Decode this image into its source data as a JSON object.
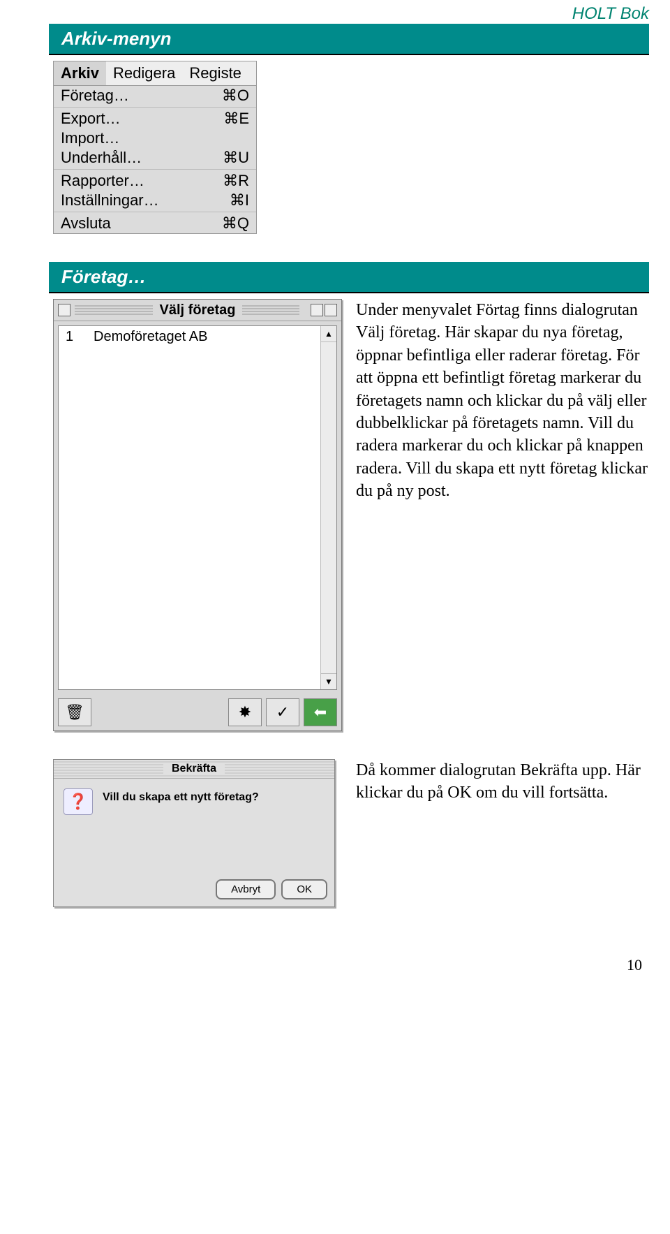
{
  "header": {
    "brand": "HOLT Bok"
  },
  "section1": {
    "title": "Arkiv-menyn"
  },
  "menu": {
    "tabs": [
      "Arkiv",
      "Redigera",
      "Registe"
    ],
    "items": [
      {
        "label": "Företag…",
        "shortcut": "⌘O"
      },
      {
        "label": "Export…",
        "shortcut": "⌘E"
      },
      {
        "label": "Import…",
        "shortcut": ""
      },
      {
        "label": "Underhåll…",
        "shortcut": "⌘U"
      },
      {
        "sep": "1"
      },
      {
        "label": "Rapporter…",
        "shortcut": "⌘R"
      },
      {
        "label": "Inställningar…",
        "shortcut": "⌘I"
      },
      {
        "sep": "1"
      },
      {
        "label": "Avsluta",
        "shortcut": "⌘Q"
      }
    ]
  },
  "section2": {
    "title": "Företag…"
  },
  "window": {
    "title": "Välj företag",
    "rows": [
      {
        "id": "1",
        "name": "Demoföretaget AB"
      }
    ]
  },
  "para1": "Under menyvalet Förtag finns dialogrutan Välj företag. Här skapar du nya företag, öppnar befintliga eller raderar företag. För att öppna ett befintligt företag markerar du företagets namn och klickar du på välj eller dubbelklickar på företagets namn. Vill du radera markerar du och klickar på knappen radera. Vill du skapa ett nytt företag klickar du på ny post.",
  "confirm": {
    "title": "Bekräfta",
    "question": "Vill du skapa ett nytt företag?",
    "cancel": "Avbryt",
    "ok": "OK"
  },
  "para2": "Då kommer dialogrutan Bekräfta upp. Här klickar du på OK om du vill fortsätta.",
  "page": "10"
}
